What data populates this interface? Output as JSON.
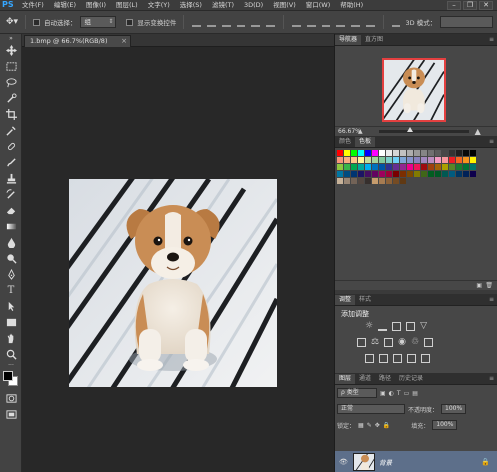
{
  "app": {
    "logo": "PS"
  },
  "menu": [
    "文件(F)",
    "编辑(E)",
    "图像(I)",
    "图层(L)",
    "文字(Y)",
    "选择(S)",
    "滤镜(T)",
    "3D(D)",
    "视图(V)",
    "窗口(W)",
    "帮助(H)"
  ],
  "window_controls": {
    "minimize": "–",
    "restore": "❐",
    "close": "✕"
  },
  "options": {
    "auto_select_label": "自动选择：",
    "auto_select_value": "组",
    "show_transform_label": "显示变换控件",
    "mode_label": "3D 模式："
  },
  "document": {
    "tab_title": "1.bmp @ 66.7%(RGB/8)",
    "close": "×"
  },
  "navigator": {
    "tabs": [
      "导航器",
      "直方图"
    ],
    "zoom": "66.67%"
  },
  "swatches_panel": {
    "tabs": [
      "颜色",
      "色板"
    ]
  },
  "adjustments": {
    "tabs": [
      "调整",
      "样式"
    ],
    "title": "添加调整"
  },
  "layers": {
    "tabs": [
      "图层",
      "通道",
      "路径",
      "历史记录"
    ],
    "filter_label": "ρ 类型",
    "blend_mode": "正常",
    "opacity_label": "不透明度：",
    "opacity_value": "100%",
    "lock_label": "锁定：",
    "fill_label": "填充：",
    "fill_value": "100%",
    "layer_name": "背景"
  },
  "colors": {
    "panel_bg": "#474747",
    "layer_selected": "#5d6f8a",
    "nav_view_box": "#e34040",
    "foreground": "#000000",
    "background": "#ffffff"
  },
  "swatch_colors": [
    "#ff0000",
    "#ffff00",
    "#00ff00",
    "#00ffff",
    "#0000ff",
    "#ff00ff",
    "#ffffff",
    "#ebebeb",
    "#d6d6d6",
    "#c2c2c2",
    "#adadad",
    "#999999",
    "#858585",
    "#707070",
    "#5c5c5c",
    "#474747",
    "#333333",
    "#1f1f1f",
    "#0a0a0a",
    "#000000",
    "#f7977a",
    "#f9ad81",
    "#fdc68a",
    "#fff79a",
    "#c4df9b",
    "#a2d39c",
    "#82ca9d",
    "#7bcdc8",
    "#6ecff6",
    "#7ea7d8",
    "#8493ca",
    "#8882be",
    "#a187be",
    "#bc8dbf",
    "#f49ac2",
    "#f6989d",
    "#ed1c24",
    "#f26522",
    "#f7941d",
    "#fff200",
    "#8dc73f",
    "#39b54a",
    "#00a651",
    "#00a99d",
    "#00aeef",
    "#0072bc",
    "#0054a6",
    "#2e3192",
    "#662d91",
    "#92278f",
    "#ec008c",
    "#ed145b",
    "#9e0b0f",
    "#a0410d",
    "#a36209",
    "#aba000",
    "#598527",
    "#197b30",
    "#007236",
    "#00746b",
    "#0076a3",
    "#004b80",
    "#003471",
    "#1b1464",
    "#440e62",
    "#630460",
    "#9e005d",
    "#9e0039",
    "#790000",
    "#7b2e00",
    "#7d4900",
    "#827b00",
    "#406618",
    "#005e20",
    "#005826",
    "#005952",
    "#005b7f",
    "#003663",
    "#002157",
    "#0d004c",
    "#c7b299",
    "#998675",
    "#736357",
    "#534741",
    "#362f2d",
    "#c69c6d",
    "#a67c52",
    "#8c6239",
    "#754c24",
    "#603913"
  ]
}
